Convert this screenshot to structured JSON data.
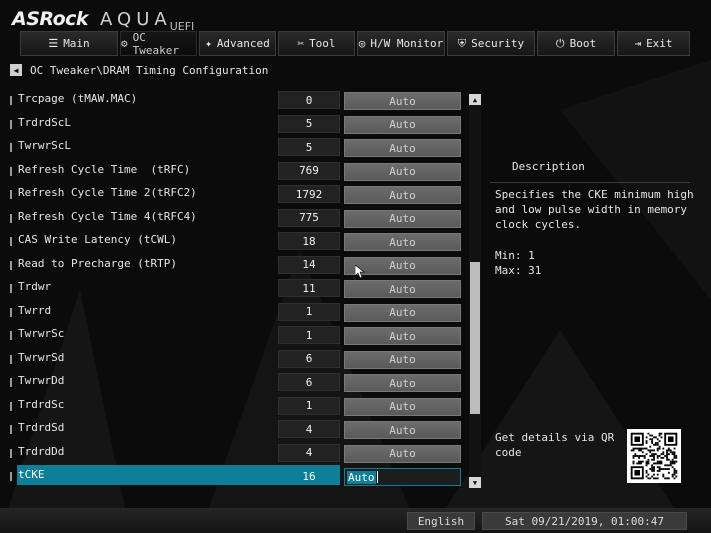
{
  "brand": {
    "logo": "ASRock",
    "product": "AQUA",
    "suffix": "UEFI"
  },
  "nav": {
    "tabs": [
      {
        "icon": "☰",
        "icon_name": "list-icon",
        "label": "Main",
        "name": "tab-main",
        "width": 98
      },
      {
        "icon": "⚙",
        "icon_name": "oc-gear-icon",
        "label": "OC Tweaker",
        "name": "tab-oc-tweaker",
        "width": 77,
        "active": true
      },
      {
        "icon": "✦",
        "icon_name": "star-icon",
        "label": "Advanced",
        "name": "tab-advanced",
        "width": 77
      },
      {
        "icon": "✂",
        "icon_name": "tools-icon",
        "label": "Tool",
        "name": "tab-tool",
        "width": 77
      },
      {
        "icon": "◎",
        "icon_name": "monitor-gauge-icon",
        "label": "H/W Monitor",
        "name": "tab-hw-monitor",
        "width": 88
      },
      {
        "icon": "⛨",
        "icon_name": "shield-icon",
        "label": "Security",
        "name": "tab-security",
        "width": 88
      },
      {
        "icon": "⏻",
        "icon_name": "power-icon",
        "label": "Boot",
        "name": "tab-boot",
        "width": 78
      },
      {
        "icon": "⇥",
        "icon_name": "exit-icon",
        "label": "Exit",
        "name": "tab-exit",
        "width": 73
      }
    ]
  },
  "breadcrumb": {
    "back_icon": "◀",
    "path": "OC Tweaker\\DRAM Timing Configuration"
  },
  "settings": [
    {
      "label": "Trcpage (tMAW.MAC)",
      "value": "0",
      "mode": "Auto"
    },
    {
      "label": "TrdrdScL",
      "value": "5",
      "mode": "Auto"
    },
    {
      "label": "TwrwrScL",
      "value": "5",
      "mode": "Auto"
    },
    {
      "label": "Refresh Cycle Time  (tRFC)",
      "value": "769",
      "mode": "Auto"
    },
    {
      "label": "Refresh Cycle Time 2(tRFC2)",
      "value": "1792",
      "mode": "Auto"
    },
    {
      "label": "Refresh Cycle Time 4(tRFC4)",
      "value": "775",
      "mode": "Auto"
    },
    {
      "label": "CAS Write Latency (tCWL)",
      "value": "18",
      "mode": "Auto"
    },
    {
      "label": "Read to Precharge (tRTP)",
      "value": "14",
      "mode": "Auto"
    },
    {
      "label": "Trdwr",
      "value": "11",
      "mode": "Auto"
    },
    {
      "label": "Twrrd",
      "value": "1",
      "mode": "Auto"
    },
    {
      "label": "TwrwrSc",
      "value": "1",
      "mode": "Auto"
    },
    {
      "label": "TwrwrSd",
      "value": "6",
      "mode": "Auto"
    },
    {
      "label": "TwrwrDd",
      "value": "6",
      "mode": "Auto"
    },
    {
      "label": "TrdrdSc",
      "value": "1",
      "mode": "Auto"
    },
    {
      "label": "TrdrdSd",
      "value": "4",
      "mode": "Auto"
    },
    {
      "label": "TrdrdDd",
      "value": "4",
      "mode": "Auto"
    },
    {
      "label": "tCKE",
      "value": "16",
      "mode": "Auto",
      "selected": true
    }
  ],
  "scrollbar": {
    "up_icon": "▲",
    "down_icon": "▼"
  },
  "description": {
    "title": "Description",
    "text": "Specifies the CKE minimum high and low pulse width in memory clock cycles.",
    "min": "Min: 1",
    "max": "Max: 31"
  },
  "qr": {
    "text": "Get details via QR code"
  },
  "footer": {
    "language": "English",
    "datetime": "Sat 09/21/2019, 01:00:47"
  },
  "colors": {
    "accent": "#0e7f99",
    "button": "#606060",
    "background": "#0b0b0b"
  }
}
